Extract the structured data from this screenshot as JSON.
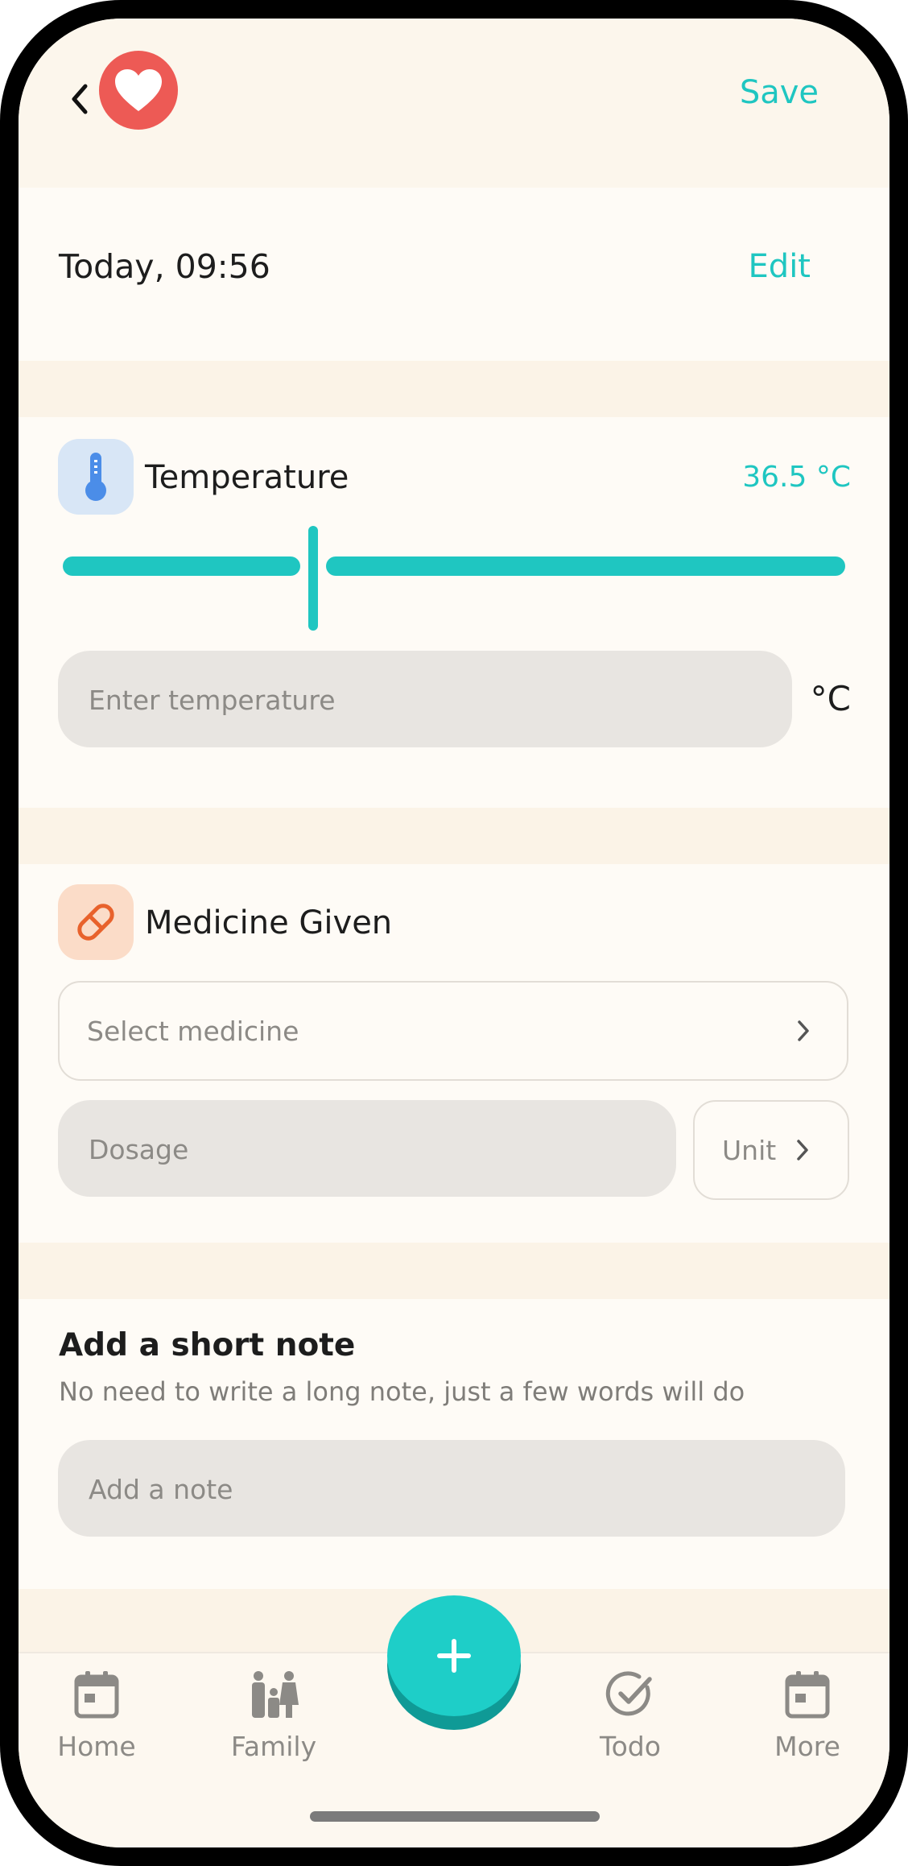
{
  "header": {
    "save_label": "Save",
    "back_icon": "chevron-left-icon",
    "logo_icon": "heart-icon",
    "logo_color": "#ed5a55"
  },
  "datetime": {
    "value": "Today, 09:56",
    "edit_label": "Edit"
  },
  "temperature": {
    "title": "Temperature",
    "value_display": "36.5 °C",
    "input_placeholder": "Enter temperature",
    "unit": "°C",
    "icon": "thermometer-icon",
    "slider_level": 0.32
  },
  "medicine": {
    "title": "Medicine Given",
    "icon": "pill-icon",
    "select_label": "Select medicine",
    "dosage_placeholder": "Dosage",
    "unit_label": "Unit"
  },
  "note": {
    "title": "Add a short note",
    "subtitle": "No need to write a long note, just a few words will do",
    "placeholder": "Add a note"
  },
  "tabbar": {
    "items": [
      {
        "label": "Home",
        "icon": "calendar-icon"
      },
      {
        "label": "Family",
        "icon": "family-icon"
      },
      {
        "label": "Todo",
        "icon": "check-circle-icon"
      },
      {
        "label": "More",
        "icon": "calendar-icon"
      }
    ],
    "fab_icon": "plus-icon"
  },
  "colors": {
    "accent": "#1fc6c1",
    "background": "#fdf8f0",
    "field": "#e8e5e1"
  }
}
